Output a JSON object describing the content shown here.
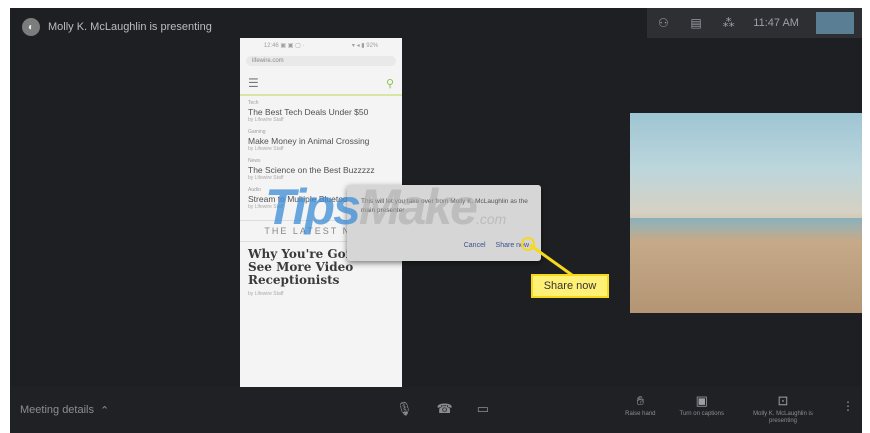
{
  "header": {
    "presenter_text": "Molly K. McLaughlin is presenting",
    "time": "11:47 AM"
  },
  "phone": {
    "status": [
      "12:46 ▣ ▣ ▢ ·",
      "▾ ◂ ▮ 92%"
    ],
    "url": "lifewire.com",
    "articles": [
      {
        "kicker": "Tech",
        "title": "The Best Tech Deals Under $50",
        "byline": "by Lifewire Staff"
      },
      {
        "kicker": "Gaming",
        "title": "Make Money in Animal Crossing",
        "byline": "by Lifewire Staff"
      },
      {
        "kicker": "News",
        "title": "The Science on the Best Buzzzzz",
        "byline": "by Lifewire Staff"
      },
      {
        "kicker": "Audio",
        "title": "Stream to Multiple Bluetooth Speakers",
        "byline": "by Lifewire Staff"
      }
    ],
    "latest_label": "THE LATEST NEWS",
    "headline": "Why You're Going To See More Video Receptionists",
    "headline_byline": "by Lifewire Staff"
  },
  "dialog": {
    "message": "This will let you take over from Molly K. McLaughlin as the main presenter",
    "cancel_label": "Cancel",
    "share_label": "Share now"
  },
  "watermark": {
    "tips": "Tips",
    "make": "Make",
    "domain": ".com"
  },
  "callout": {
    "label": "Share now"
  },
  "bottom": {
    "meeting_details": "Meeting details",
    "raise_hand": "Raise hand",
    "captions": "Turn on captions",
    "presenting": "Molly K. McLaughlin is presenting"
  },
  "colors": {
    "callout_fill": "#fff176",
    "callout_border": "#f6d91c",
    "watermark_blue": "#3c8cd7"
  }
}
